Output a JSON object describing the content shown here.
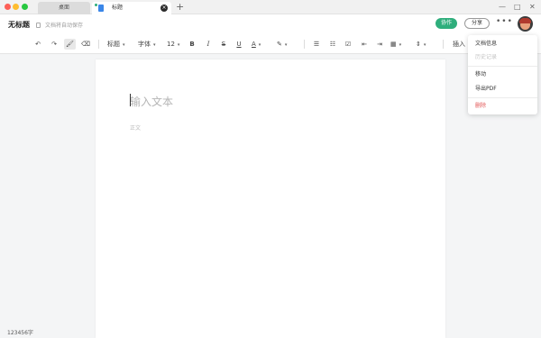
{
  "tabs": {
    "home": "桌面",
    "active": "标题",
    "close_glyph": "×",
    "add_glyph": "+"
  },
  "window_controls": {
    "minimize": "—",
    "maximize": "□",
    "close": "✕"
  },
  "header": {
    "doc_title": "无标题",
    "save_status": "文档将自动保存",
    "collaborate_label": "协作",
    "share_label": "分享",
    "more_label": "•••"
  },
  "toolbar": {
    "undo": "↶",
    "redo": "↷",
    "format_painter": "🖌",
    "clear_format": "⌫",
    "heading_label": "标题",
    "font_label": "字体",
    "font_size": "12",
    "bold": "B",
    "italic": "I",
    "strikethrough": "S",
    "underline": "U",
    "font_color": "A",
    "highlight": "✎",
    "unordered_list": "☰",
    "ordered_list": "☷",
    "checklist": "☑",
    "align_left": "⇤",
    "align_right": "⇥",
    "table": "▦",
    "line_height": "⇕",
    "insert_label": "插入",
    "dropdown_caret": "▾"
  },
  "document": {
    "title_placeholder": "输入文本",
    "body_placeholder": "正文"
  },
  "menu": {
    "items": [
      {
        "label": "文档信息",
        "state": "enabled"
      },
      {
        "label": "历史记录",
        "state": "disabled"
      },
      {
        "label": "移动",
        "state": "enabled"
      },
      {
        "label": "导出PDF",
        "state": "enabled"
      },
      {
        "label": "删除",
        "state": "danger"
      }
    ]
  },
  "footer": {
    "word_count": "123456字"
  },
  "colors": {
    "accent": "#2fae7c",
    "danger": "#e25555",
    "tab_doc_icon": "#3a86e8"
  }
}
